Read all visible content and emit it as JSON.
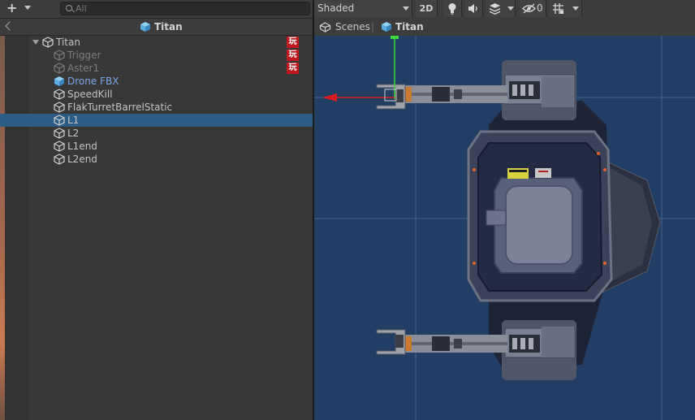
{
  "hierarchy": {
    "add_label": "+",
    "search": {
      "placeholder": "All",
      "value": ""
    },
    "title": "Titan",
    "badge_text": "玩",
    "items": [
      {
        "label": "Titan",
        "state": "normal",
        "badge": true,
        "expanded": true
      },
      {
        "label": "Trigger",
        "state": "dim",
        "badge": true
      },
      {
        "label": "Aster1",
        "state": "dim",
        "badge": true
      },
      {
        "label": "Drone FBX",
        "state": "prefab",
        "badge": false
      },
      {
        "label": "SpeedKill",
        "state": "normal",
        "badge": false
      },
      {
        "label": "FlakTurretBarrelStatic",
        "state": "normal",
        "badge": false
      },
      {
        "label": "L1",
        "state": "selected",
        "badge": false
      },
      {
        "label": "L2",
        "state": "normal",
        "badge": false
      },
      {
        "label": "L1end",
        "state": "normal",
        "badge": false
      },
      {
        "label": "L2end",
        "state": "normal",
        "badge": false
      }
    ]
  },
  "scene": {
    "toolbar": {
      "shading_mode": "Shaded",
      "mode_2d_label": "2D",
      "hidden_count": "0",
      "icons": [
        "lightbulb-icon",
        "speaker-icon",
        "effects-icon",
        "visibility-icon",
        "grid-icon"
      ]
    },
    "breadcrumbs": {
      "root": "Scenes",
      "separator": "|",
      "current": "Titan"
    }
  },
  "colors": {
    "selection": "#2c5d87",
    "viewport_bg": "#213e64",
    "badge": "#c0181d",
    "prefab_text": "#7aa6e8",
    "gizmo_x": "#d81e1e",
    "gizmo_y": "#3ad83a"
  }
}
